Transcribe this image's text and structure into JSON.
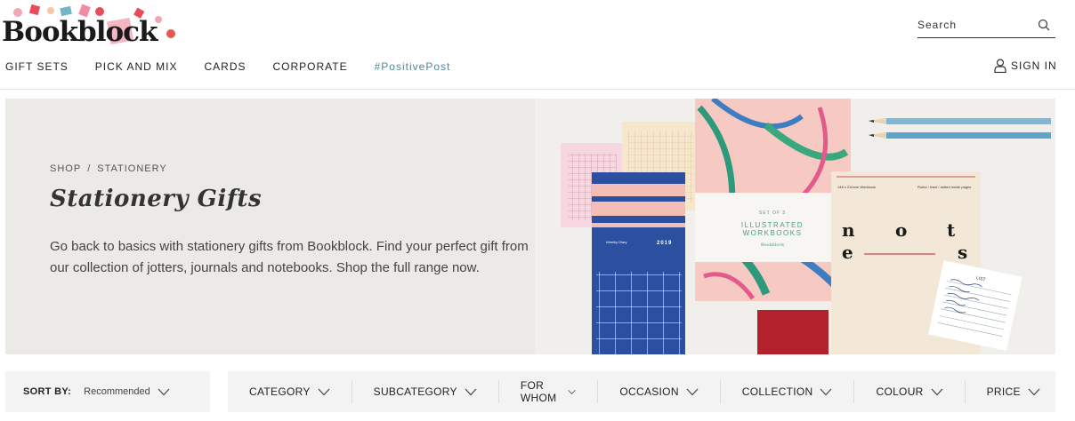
{
  "header": {
    "logo_text": "Bookblock",
    "search": {
      "placeholder": "Search"
    },
    "nav": [
      "GIFT SETS",
      "PICK AND MIX",
      "CARDS",
      "CORPORATE",
      "#PositivePost"
    ],
    "signin_label": "SIGN IN"
  },
  "hero": {
    "breadcrumb": [
      "SHOP",
      "STATIONERY"
    ],
    "breadcrumb_sep": "/",
    "title": "Stationery Gifts",
    "description": "Go back to basics with stationery gifts from Bookblock. Find your perfect gift from our collection of jotters, journals and notebooks. Shop the full range now.",
    "image_text": {
      "diary_label": "Weekly Diary",
      "diary_year": "2019",
      "set_label": "SET OF 3",
      "set_title_1": "ILLUSTRATED",
      "set_title_2": "WORKBOOKS",
      "set_brand": "Bookblock",
      "notes_size": "148 x 210mm Workbook",
      "notes_ruling": "Ruled / lined / dotted inside pages",
      "notes_letters": [
        "n",
        "o",
        "t",
        "e",
        "s"
      ],
      "list_title": "LIST"
    }
  },
  "sort": {
    "label": "SORT BY:",
    "value": "Recommended"
  },
  "filters": [
    "CATEGORY",
    "SUBCATEGORY",
    "FOR WHOM",
    "OCCASION",
    "COLLECTION",
    "COLOUR",
    "PRICE"
  ],
  "colors": {
    "accent_teal": "#4b8c96",
    "hero_bg": "#eceae7",
    "filter_bg": "#f3f3f3"
  },
  "icons": {
    "search": "search-icon",
    "user": "user-icon",
    "chevron": "chevron-down-icon"
  }
}
